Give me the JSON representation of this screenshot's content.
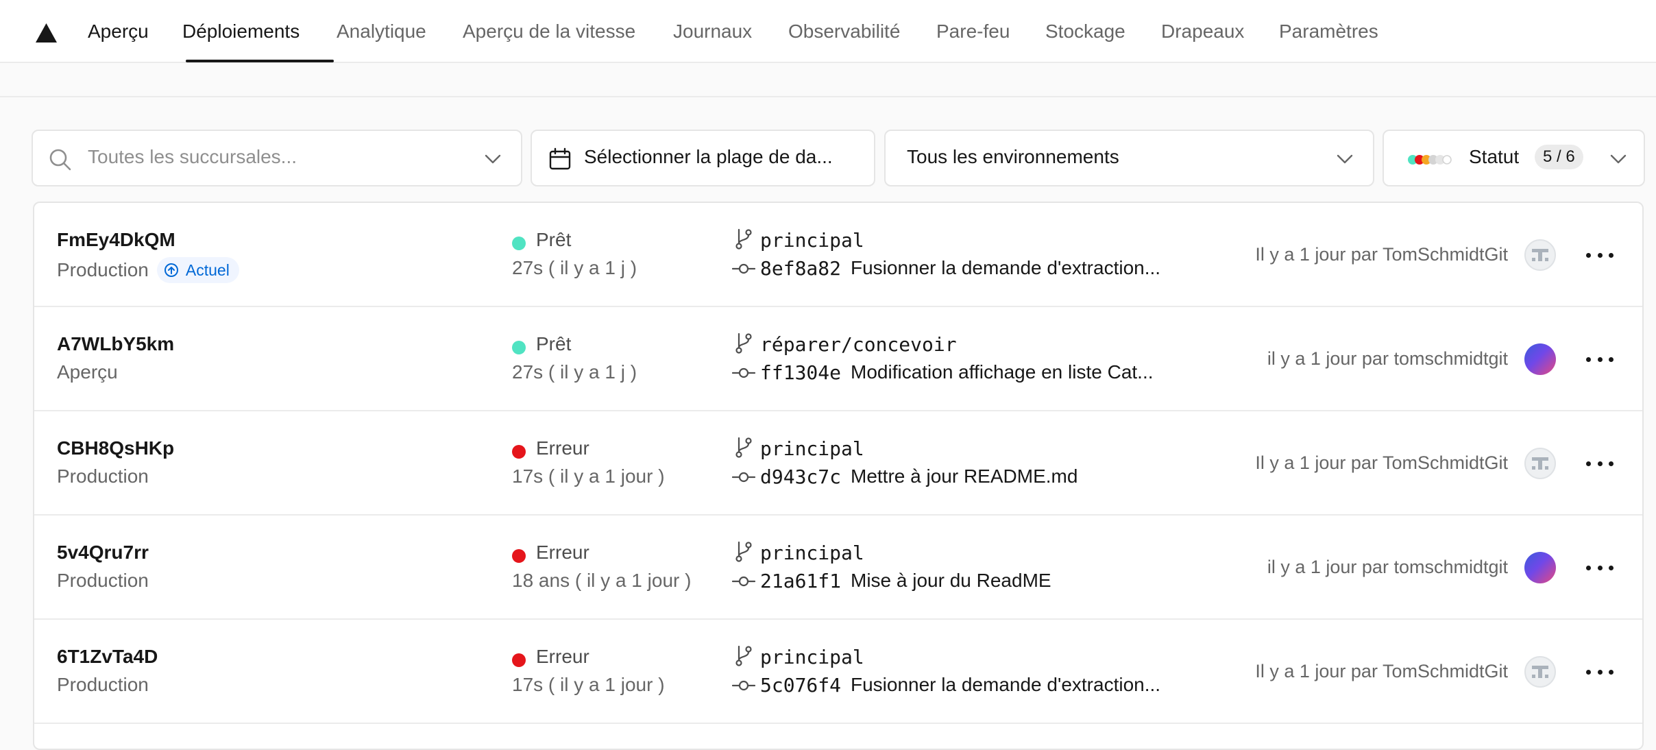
{
  "nav": {
    "tabs": [
      {
        "label": "Aperçu"
      },
      {
        "label": "Déploiements"
      },
      {
        "label": "Analytique"
      },
      {
        "label": "Aperçu de la vitesse"
      },
      {
        "label": "Journaux"
      },
      {
        "label": "Observabilité"
      },
      {
        "label": "Pare-feu"
      },
      {
        "label": "Stockage"
      },
      {
        "label": "Drapeaux"
      },
      {
        "label": "Paramètres"
      }
    ],
    "active_tab": "Déploiements"
  },
  "filters": {
    "branch_placeholder": "Toutes les succursales...",
    "date_label": "Sélectionner la plage de da...",
    "environment_label": "Tous les environnements",
    "status_label": "Statut",
    "status_count": "5 / 6"
  },
  "colors": {
    "ready": "#50e3c2",
    "error": "#e5151b"
  },
  "deployments": [
    {
      "id": "FmEy4DkQM",
      "environment": "Production",
      "badge": "Actuel",
      "status": "Prêt",
      "status_kind": "ready",
      "duration": "27s ( il y a 1 j )",
      "branch": "principal",
      "commit_hash": "8ef8a82",
      "commit_message": "Fusionner la demande d'extraction...",
      "byline": "Il y a 1 jour par TomSchmidtGit",
      "avatar": "t-icon"
    },
    {
      "id": "A7WLbY5km",
      "environment": "Aperçu",
      "badge": null,
      "status": "Prêt",
      "status_kind": "ready",
      "duration": "27s ( il y a 1 j )",
      "branch": "réparer/concevoir",
      "commit_hash": "ff1304e",
      "commit_message": "Modification affichage en liste Cat...",
      "byline": "il y a 1 jour par tomschmidtgit",
      "avatar": "gradient"
    },
    {
      "id": "CBH8QsHKp",
      "environment": "Production",
      "badge": null,
      "status": "Erreur",
      "status_kind": "error",
      "duration": "17s ( il y a 1 jour )",
      "branch": "principal",
      "commit_hash": "d943c7c",
      "commit_message": "Mettre à jour README.md",
      "byline": "Il y a 1 jour par TomSchmidtGit",
      "avatar": "t-icon"
    },
    {
      "id": "5v4Qru7rr",
      "environment": "Production",
      "badge": null,
      "status": "Erreur",
      "status_kind": "error",
      "duration": "18 ans ( il y a 1 jour )",
      "branch": "principal",
      "commit_hash": "21a61f1",
      "commit_message": "Mise à jour du ReadME",
      "byline": "il y a 1 jour par tomschmidtgit",
      "avatar": "gradient"
    },
    {
      "id": "6T1ZvTa4D",
      "environment": "Production",
      "badge": null,
      "status": "Erreur",
      "status_kind": "error",
      "duration": "17s ( il y a 1 jour )",
      "branch": "principal",
      "commit_hash": "5c076f4",
      "commit_message": "Fusionner la demande d'extraction...",
      "byline": "Il y a 1 jour par TomSchmidtGit",
      "avatar": "t-icon"
    }
  ]
}
